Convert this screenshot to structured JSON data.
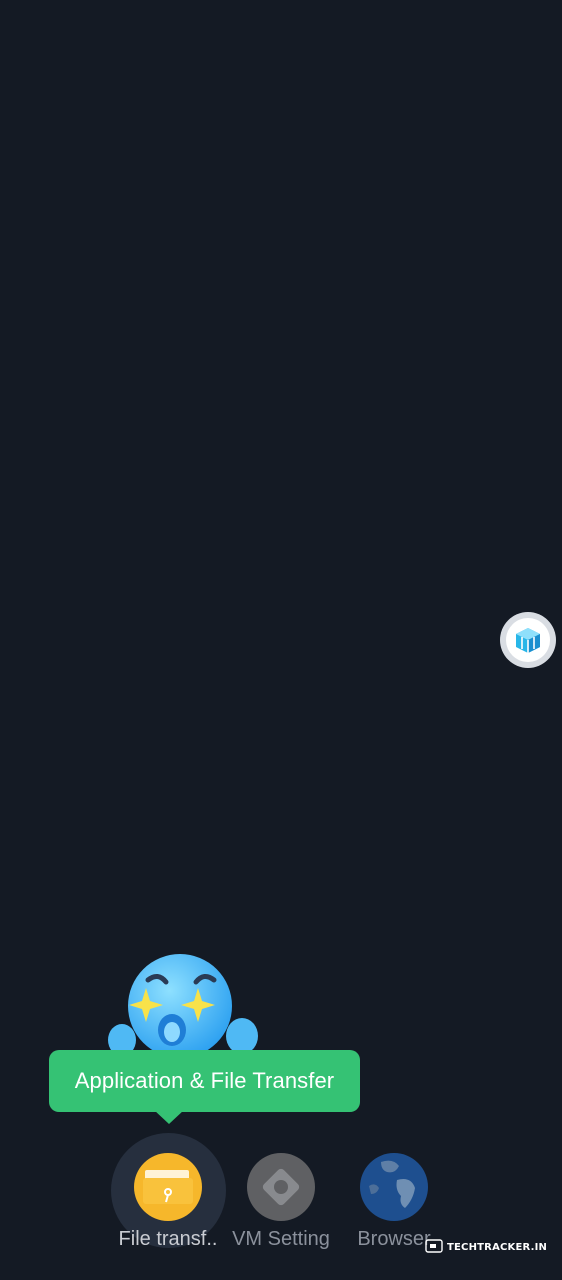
{
  "tooltip": {
    "text": "Application & File Transfer"
  },
  "dock": {
    "items": [
      {
        "label": "File transf..",
        "icon": "folder-icon",
        "active": true
      },
      {
        "label": "VM Setting",
        "icon": "gear-icon",
        "active": false
      },
      {
        "label": "Browser",
        "icon": "globe-icon",
        "active": false
      }
    ]
  },
  "floating_button": {
    "icon": "cube-icon"
  },
  "mascot": {
    "icon": "mascot-icon"
  },
  "watermark": {
    "text": "TECHTRACKER.IN"
  },
  "colors": {
    "background": "#141a24",
    "tooltip": "#35c274",
    "folder": "#f6b72b",
    "globe": "#1e4f8f"
  }
}
